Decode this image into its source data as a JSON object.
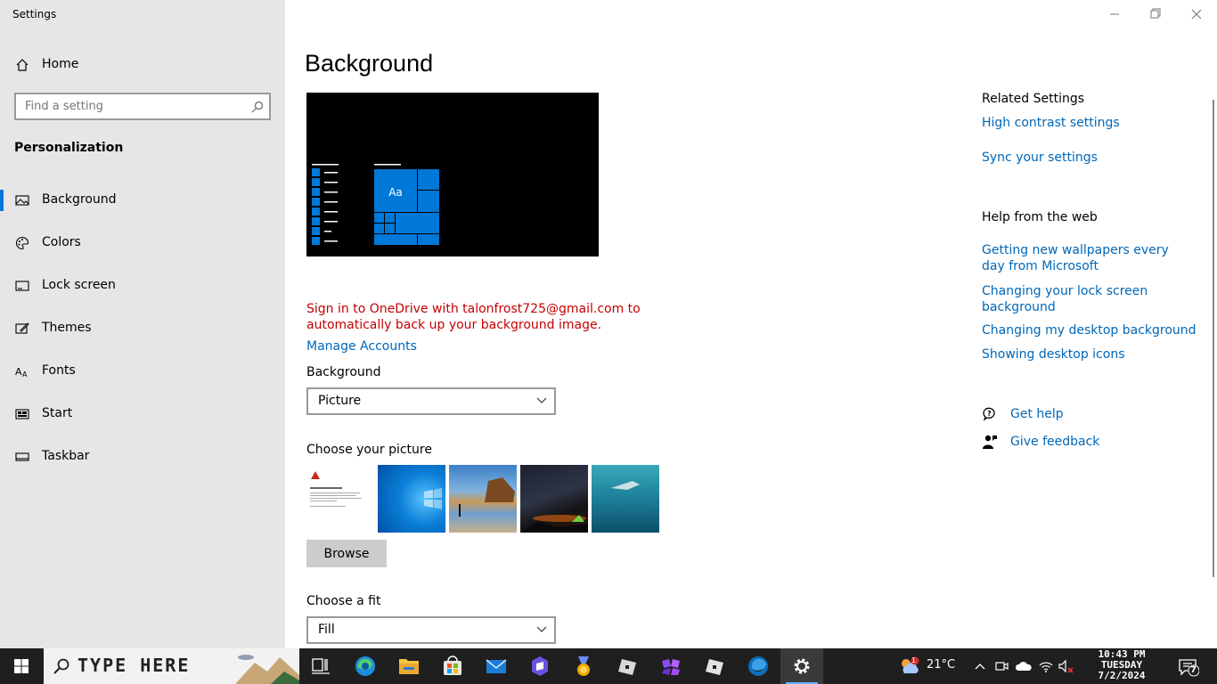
{
  "window": {
    "title": "Settings"
  },
  "sidebar": {
    "home": "Home",
    "search_placeholder": "Find a setting",
    "section": "Personalization",
    "items": [
      {
        "label": "Background",
        "icon": "picture-icon",
        "selected": true
      },
      {
        "label": "Colors",
        "icon": "palette-icon"
      },
      {
        "label": "Lock screen",
        "icon": "lock-screen-icon"
      },
      {
        "label": "Themes",
        "icon": "themes-icon"
      },
      {
        "label": "Fonts",
        "icon": "fonts-icon"
      },
      {
        "label": "Start",
        "icon": "start-icon"
      },
      {
        "label": "Taskbar",
        "icon": "taskbar-icon"
      }
    ]
  },
  "main": {
    "title": "Background",
    "preview_sample": "Aa",
    "warning": "Sign in to OneDrive with talonfrost725@gmail.com to automatically back up your background image.",
    "manage_accounts": "Manage Accounts",
    "background_label": "Background",
    "background_value": "Picture",
    "choose_picture_label": "Choose your picture",
    "browse_label": "Browse",
    "fit_label": "Choose a fit",
    "fit_value": "Fill"
  },
  "related": {
    "title": "Related Settings",
    "links": [
      "High contrast settings",
      "Sync your settings"
    ],
    "help_title": "Help from the web",
    "help_links": [
      "Getting new wallpapers every day from Microsoft",
      "Changing your lock screen background",
      "Changing my desktop background",
      "Showing desktop icons"
    ],
    "get_help": "Get help",
    "give_feedback": "Give feedback"
  },
  "taskbar": {
    "search_text": "TYPE HERE",
    "weather": "21°C",
    "weather_badge": "1",
    "time": "10:43 PM",
    "day": "TUESDAY",
    "date": "7/2/2024",
    "notification_count": "7"
  },
  "colors": {
    "accent": "#0078d7",
    "link": "#0067b8",
    "warning": "#c40000"
  }
}
